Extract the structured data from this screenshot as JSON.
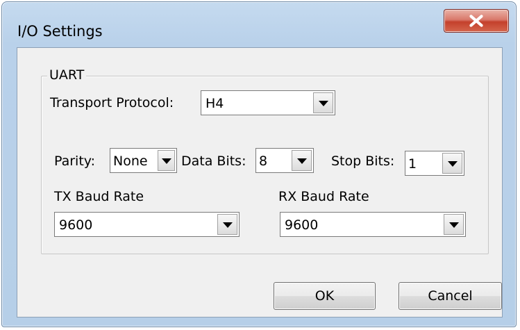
{
  "window": {
    "title": "I/O Settings"
  },
  "icons": {
    "close": "close-icon",
    "dropdown": "chevron-down-icon"
  },
  "uart": {
    "group_label": "UART",
    "transport_protocol": {
      "label": "Transport Protocol:",
      "value": "H4"
    },
    "parity": {
      "label": "Parity:",
      "value": "None"
    },
    "data_bits": {
      "label": "Data Bits:",
      "value": "8"
    },
    "stop_bits": {
      "label": "Stop Bits:",
      "value": "1"
    },
    "tx_baud_rate": {
      "label": "TX Baud Rate",
      "value": "9600"
    },
    "rx_baud_rate": {
      "label": "RX Baud Rate",
      "value": "9600"
    }
  },
  "buttons": {
    "ok": "OK",
    "cancel": "Cancel"
  },
  "colors": {
    "close_button": "#c4402c",
    "title_bar": "#b9d1ea",
    "client": "#f0f0f0"
  }
}
